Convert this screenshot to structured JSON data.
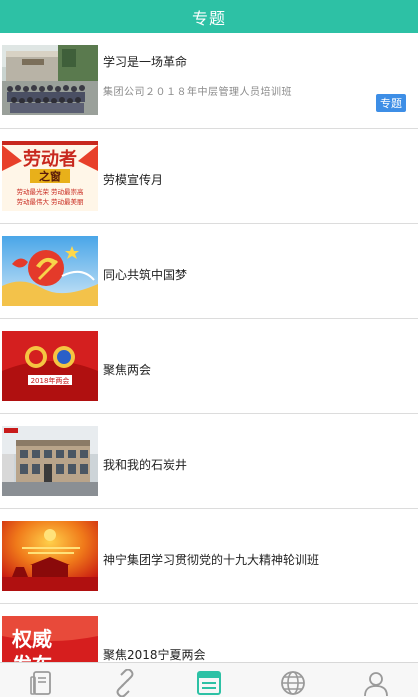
{
  "header": {
    "title": "专题"
  },
  "items": [
    {
      "title": "学习是一场革命",
      "subtitle": "集团公司２０１８年中层管理人员培训班",
      "badge": "专题",
      "thumb_icon": "group-photo-image"
    },
    {
      "title": "劳模宣传月",
      "thumb_icon": "model-worker-window-image",
      "thumb_text": {
        "line1": "劳动者",
        "line2": "之窗",
        "line3": "劳动最光荣 劳动最崇高",
        "line4": "劳动最伟大 劳动最美丽"
      }
    },
    {
      "title": "同心共筑中国梦",
      "thumb_icon": "china-dream-image"
    },
    {
      "title": "聚焦两会",
      "thumb_icon": "two-sessions-image",
      "thumb_text": {
        "line1": "2018年两会"
      }
    },
    {
      "title": "我和我的石炭井",
      "thumb_icon": "shitanjing-building-image"
    },
    {
      "title": "神宁集团学习贯彻党的十九大精神轮训班",
      "thumb_icon": "training-banner-image"
    },
    {
      "title": "聚焦2018宁夏两会",
      "thumb_icon": "authority-release-image",
      "thumb_text": {
        "line1": "权威",
        "line2": "发布"
      }
    }
  ],
  "bottom_nav": [
    {
      "icon": "news-icon"
    },
    {
      "icon": "link-icon"
    },
    {
      "icon": "topics-icon",
      "active": true
    },
    {
      "icon": "globe-icon"
    },
    {
      "icon": "user-icon"
    }
  ],
  "colors": {
    "header": "#2dc1a5",
    "badge": "#3d8ee6",
    "nav_active": "#2dc1a5",
    "nav_inactive": "#9a9a9a"
  }
}
